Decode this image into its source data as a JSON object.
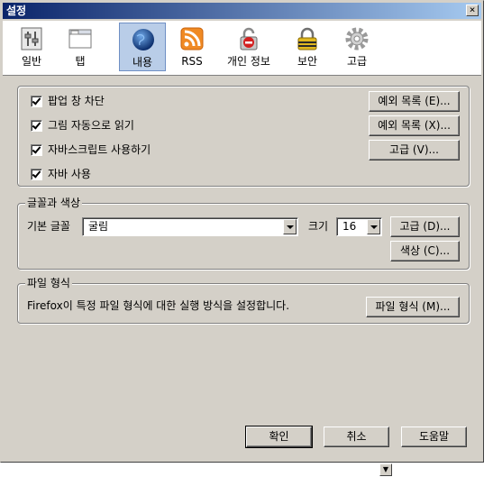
{
  "window": {
    "title": "설정",
    "close_glyph": "×"
  },
  "toolbar": {
    "tabs": [
      {
        "label": "일반",
        "icon": "general-icon"
      },
      {
        "label": "탭",
        "icon": "tabs-icon"
      },
      {
        "label": "내용",
        "icon": "content-icon",
        "active": true
      },
      {
        "label": "RSS",
        "icon": "rss-icon"
      },
      {
        "label": "개인 정보",
        "icon": "privacy-icon"
      },
      {
        "label": "보안",
        "icon": "security-icon"
      },
      {
        "label": "고급",
        "icon": "advanced-icon"
      }
    ]
  },
  "content": {
    "options": [
      {
        "label": "팝업 창 차단",
        "checked": true
      },
      {
        "label": "그림 자동으로 읽기",
        "checked": true
      },
      {
        "label": "자바스크립트 사용하기",
        "checked": true
      },
      {
        "label": "자바 사용",
        "checked": true
      }
    ],
    "exceptions_popup_label": "예외 목록 (E)...",
    "exceptions_images_label": "예외 목록 (X)...",
    "js_advanced_label": "고급 (V)..."
  },
  "fonts": {
    "legend": "글꼴과 색상",
    "default_font_label": "기본 글꼴",
    "default_font_value": "굴림",
    "size_label": "크기",
    "size_value": "16",
    "advanced_label": "고급 (D)...",
    "colors_label": "색상 (C)..."
  },
  "filetypes": {
    "legend": "파일 형식",
    "description": "Firefox이 특정 파일 형식에 대한 실행 방식을 설정합니다.",
    "button_label": "파일 형식 (M)..."
  },
  "footer": {
    "ok_label": "확인",
    "cancel_label": "취소",
    "help_label": "도움말"
  }
}
